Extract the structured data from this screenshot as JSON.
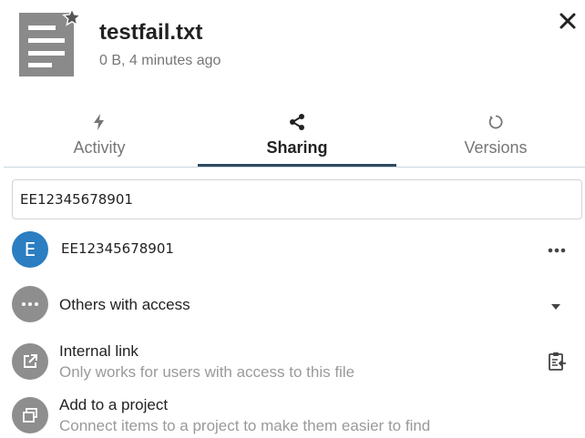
{
  "file": {
    "name": "testfail.txt",
    "meta": "0 B, 4 minutes ago",
    "icon": "text-file-icon",
    "favorite_icon": "star-icon"
  },
  "close_icon": "close-icon",
  "tabs": [
    {
      "label": "Activity",
      "icon": "activity-icon",
      "active": false
    },
    {
      "label": "Sharing",
      "icon": "share-icon",
      "active": true
    },
    {
      "label": "Versions",
      "icon": "history-icon",
      "active": false
    }
  ],
  "share_input": {
    "value": "EE12345678901"
  },
  "shares": [
    {
      "avatar_letter": "E",
      "name": "EE12345678901",
      "avatar_color": "#2b7ec1",
      "menu_icon": "more-icon"
    }
  ],
  "others_with_access": {
    "label": "Others with access",
    "icon": "more-icon",
    "toggle_icon": "caret-down-icon"
  },
  "internal_link": {
    "title": "Internal link",
    "subtitle": "Only works for users with access to this file",
    "icon": "external-link-icon",
    "copy_icon": "clipboard-icon"
  },
  "project": {
    "title": "Add to a project",
    "subtitle": "Connect items to a project to make them easier to find",
    "icon": "project-icon"
  },
  "colors": {
    "accent": "#2f4b5e",
    "avatar_blue": "#2b7ec1",
    "avatar_grey": "#8e8e8e",
    "muted_text": "#767676"
  }
}
